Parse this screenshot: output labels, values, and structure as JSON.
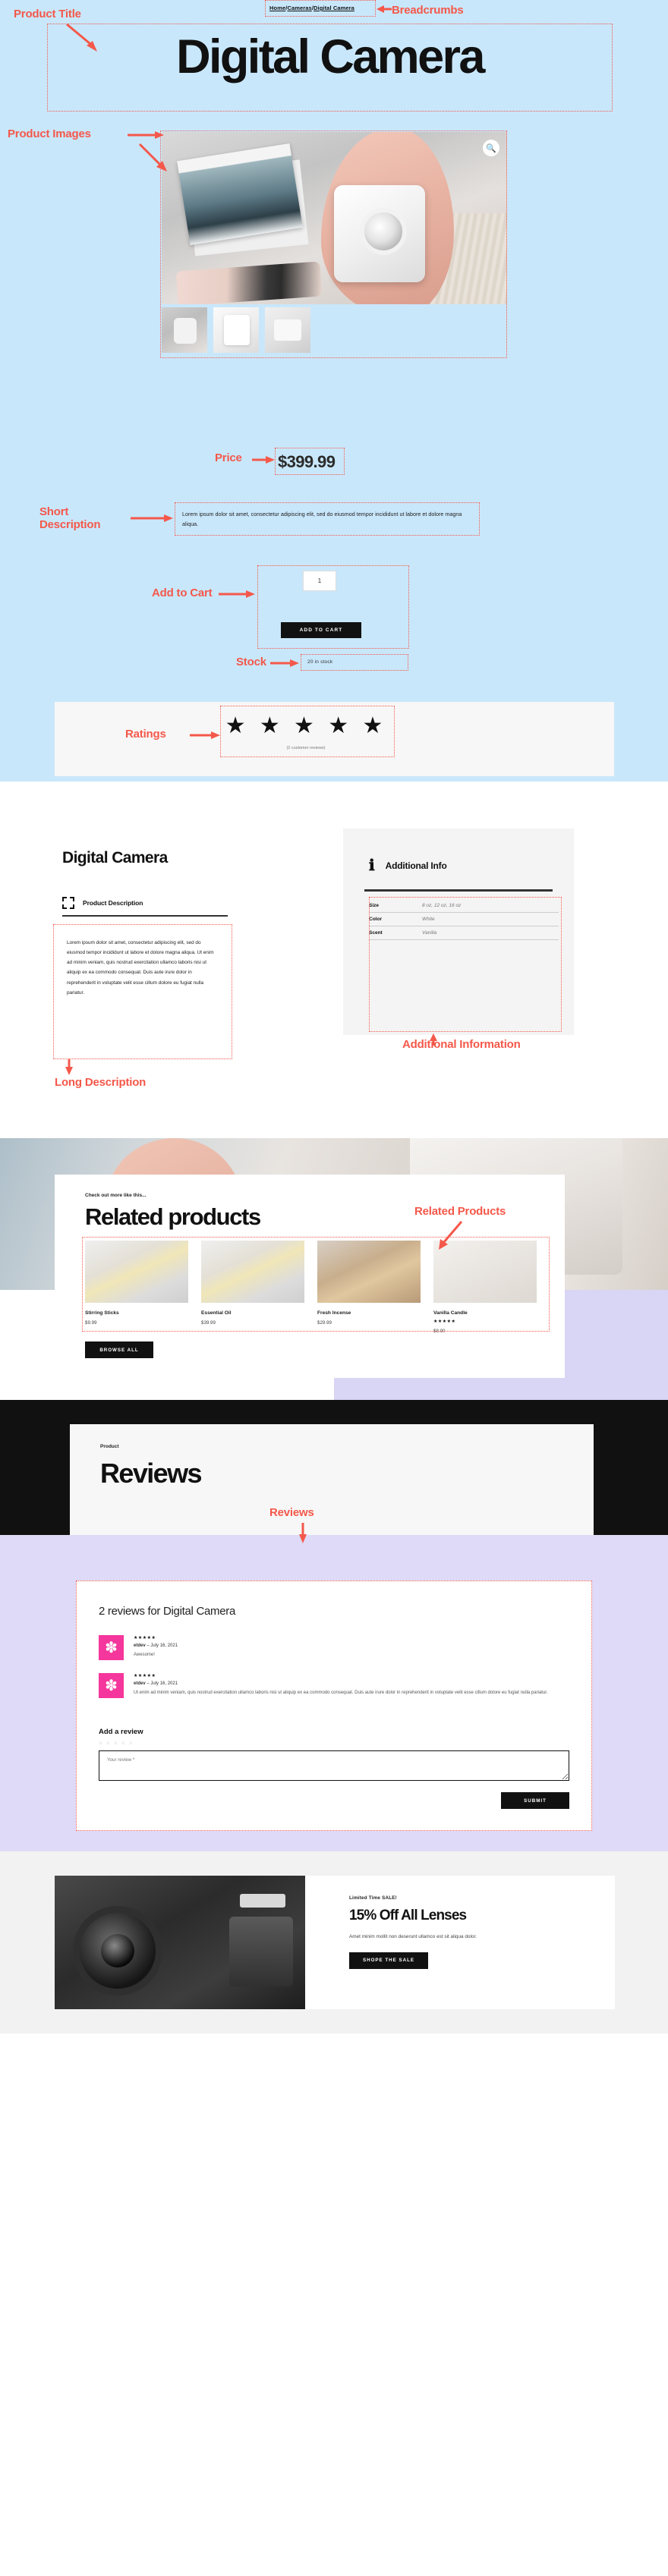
{
  "annotations": {
    "product_title": "Product Title",
    "breadcrumbs": "Breadcrumbs",
    "product_images": "Product Images",
    "price": "Price",
    "short_description": "Short\nDescription",
    "add_to_cart": "Add to Cart",
    "stock": "Stock",
    "ratings": "Ratings",
    "long_description": "Long Description",
    "additional_information": "Additional Information",
    "related_products": "Related Products",
    "reviews": "Reviews"
  },
  "breadcrumb": {
    "home": "Home",
    "category": "Cameras",
    "current": "Digital Camera",
    "separator": "/"
  },
  "hero": {
    "title": "Digital Camera",
    "zoom_icon": "search-icon",
    "price": "$399.99",
    "short_description": "Lorem ipsum dolor sit amet, consectetur adipiscing elit, sed do eiusmod tempor incididunt ut labore et dolore magna aliqua.",
    "quantity": "1",
    "add_to_cart_label": "ADD TO CART",
    "stock_label": "20 in stock",
    "stars": "★ ★ ★ ★ ★",
    "rating_caption": "(2 customer reviews)"
  },
  "description_section": {
    "title": "Digital Camera",
    "subtitle": "Product Description",
    "subtitle_icon": "frame-icon",
    "body": "Lorem ipsum dolor sit amet, consectetur adipiscing elit, sed do eiusmod tempor incididunt ut labore et dolore magna aliqua. Ut enim ad minim veniam, quis nostrud exercitation ullamco laboris nisi ut aliquip ex ea commodo consequat. Duis aute irure dolor in reprehenderit in voluptate velit esse cillum dolore eu fugiat nulla pariatur."
  },
  "additional_info": {
    "title": "Additional Info",
    "icon": "info-icon",
    "rows": [
      {
        "key": "Size",
        "value": "8 oz, 12 oz, 16 oz"
      },
      {
        "key": "Color",
        "value": "White"
      },
      {
        "key": "Scent",
        "value": "Vanilla"
      }
    ]
  },
  "related": {
    "eyebrow": "Check out more like this...",
    "title": "Related products",
    "browse_all_label": "BROWSE ALL",
    "products": [
      {
        "name": "Stirring Sticks",
        "price": "$9.99",
        "stars": ""
      },
      {
        "name": "Essential Oil",
        "price": "$39.99",
        "stars": ""
      },
      {
        "name": "Fresh Incense",
        "price": "$29.99",
        "stars": ""
      },
      {
        "name": "Vanilla Candle",
        "price": "$8.00",
        "stars": "★★★★★"
      }
    ]
  },
  "reviews": {
    "eyebrow": "Product",
    "title": "Reviews",
    "heading": "2 reviews for Digital Camera",
    "items": [
      {
        "stars": "★★★★★",
        "author": "etdev",
        "date": "July 16, 2021",
        "separator": "–",
        "text": "Awesome!"
      },
      {
        "stars": "★★★★★",
        "author": "etdev",
        "date": "July 16, 2021",
        "separator": "–",
        "text": "Ut enim ad minim veniam, quis nostrud exercitation ullamco laboris nisi ut aliquip ex ea commodo consequat. Duis aute irure dolor in reprehenderit in voluptate velit esse cillum dolore eu fugiat nulla pariatur."
      }
    ],
    "add_review_title": "Add a review",
    "add_review_stars": "☆ ☆ ☆ ☆ ☆",
    "review_placeholder": "Your review *",
    "submit_label": "SUBMIT"
  },
  "promo": {
    "eyebrow": "Limited Time SALE!",
    "title": "15% Off All Lenses",
    "text": "Amet minim mollit non deserunt ullamco est sit aliqua dolor.",
    "button_label": "SHOPE THE SALE"
  },
  "colors": {
    "hero_bg": "#c9e7fb",
    "annotation": "#f4584a",
    "lavender": "#dedaf7",
    "black": "#111111",
    "avatar_pink": "#f5369c"
  }
}
